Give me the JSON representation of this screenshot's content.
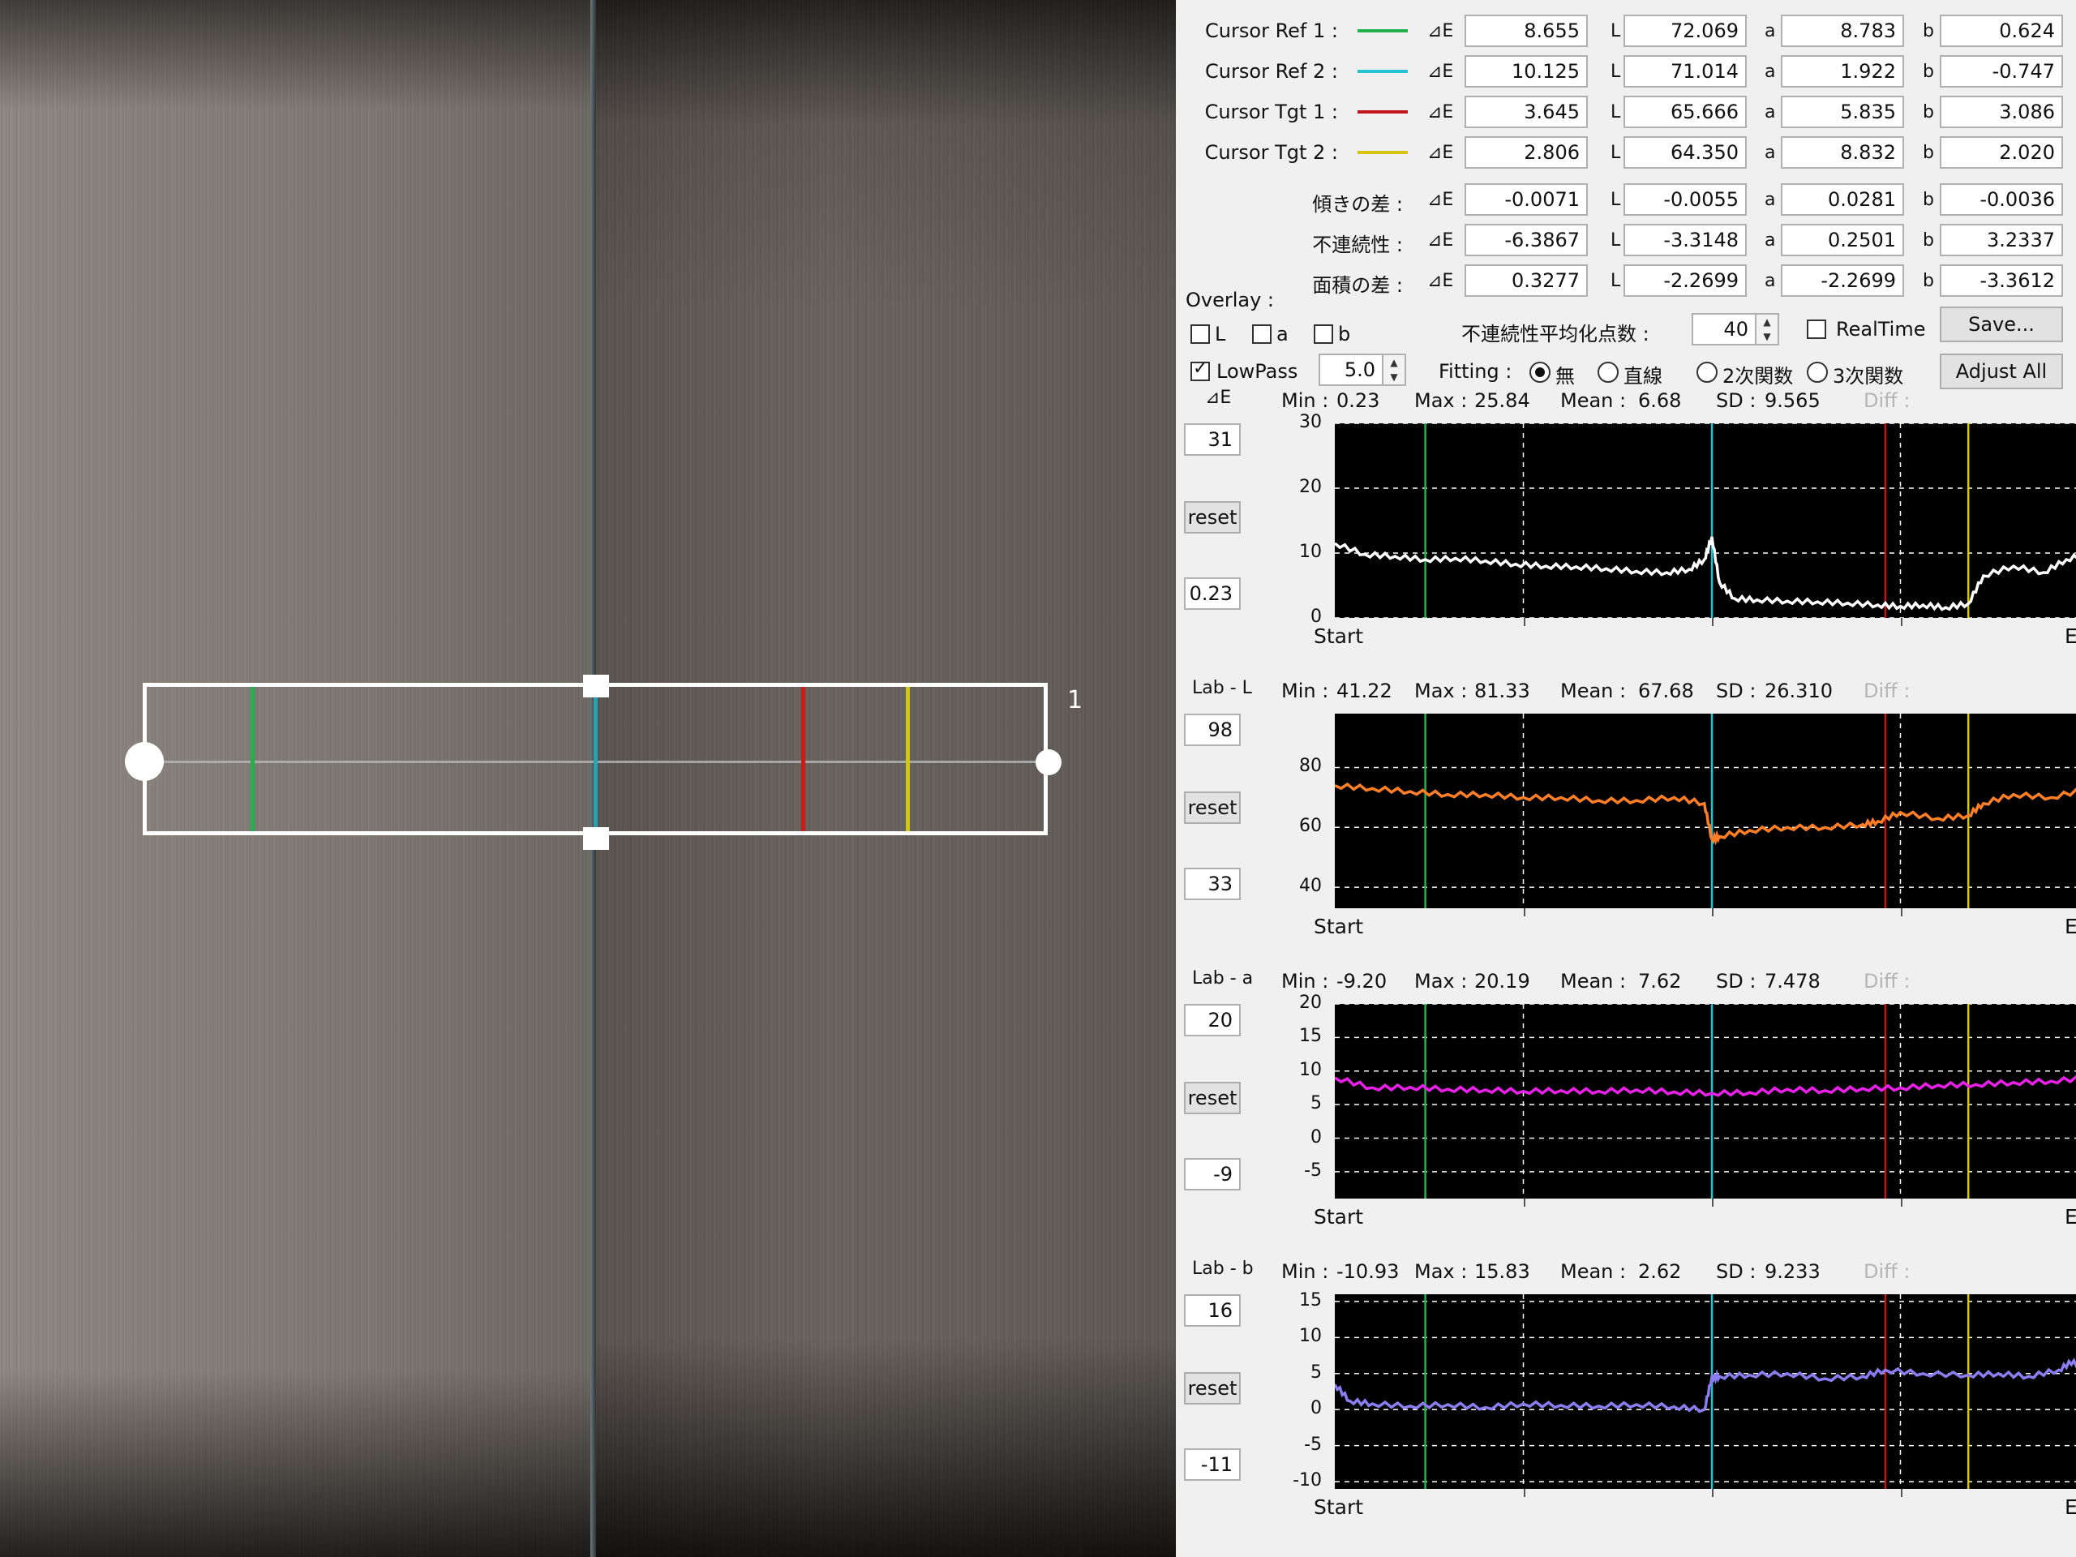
{
  "cursor_rows": [
    {
      "label": "Cursor Ref 1 :",
      "color": "#22b14c",
      "de": "8.655",
      "L": "72.069",
      "a": "8.783",
      "b": "0.624"
    },
    {
      "label": "Cursor Ref 2 :",
      "color": "#27c4cf",
      "de": "10.125",
      "L": "71.014",
      "a": "1.922",
      "b": "-0.747"
    },
    {
      "label": "Cursor Tgt 1 :",
      "color": "#c0151a",
      "de": "3.645",
      "L": "65.666",
      "a": "5.835",
      "b": "3.086"
    },
    {
      "label": "Cursor Tgt 2 :",
      "color": "#d6c413",
      "de": "2.806",
      "L": "64.350",
      "a": "8.832",
      "b": "2.020"
    }
  ],
  "metric_rows": [
    {
      "label": "傾きの差 :",
      "de": "-0.0071",
      "L": "-0.0055",
      "a": "0.0281",
      "b": "-0.0036"
    },
    {
      "label": "不連続性 :",
      "de": "-6.3867",
      "L": "-3.3148",
      "a": "0.2501",
      "b": "3.2337"
    },
    {
      "label": "面積の差 :",
      "de": "0.3277",
      "L": "-2.2699",
      "a": "-2.2699",
      "b": "-3.3612"
    }
  ],
  "col_labels": {
    "de": "⊿E",
    "L": "L",
    "a": "a",
    "b": "b"
  },
  "overlay": {
    "title": "Overlay :",
    "checks": [
      {
        "label": "L",
        "checked": false
      },
      {
        "label": "a",
        "checked": false
      },
      {
        "label": "b",
        "checked": false
      }
    ],
    "smoothing_label": "不連続性平均化点数 :",
    "smoothing_value": "40",
    "realtime_label": "RealTime",
    "realtime_checked": false,
    "save_label": "Save...",
    "lowpass_label": "LowPass",
    "lowpass_checked": true,
    "lowpass_value": "5.0",
    "fitting_label": "Fitting :",
    "fitting_options": [
      {
        "label": "無",
        "selected": true
      },
      {
        "label": "直線",
        "selected": false
      },
      {
        "label": "2次関数",
        "selected": false
      },
      {
        "label": "3次関数",
        "selected": false
      }
    ],
    "adjust_label": "Adjust All"
  },
  "image": {
    "roi_label": "1"
  },
  "stat_labels": {
    "min": "Min :",
    "max": "Max :",
    "mean": "Mean :",
    "sd": "SD :",
    "diff": "Diff :",
    "reset": "reset",
    "start": "Start",
    "end": "End"
  },
  "chart_data": [
    {
      "type": "line",
      "title": "⊿E",
      "color": "#ffffff",
      "min": "0.23",
      "max": "25.84",
      "mean": "6.68",
      "sd": "9.565",
      "range_top": "31",
      "range_bottom": "0.23",
      "ylim": [
        0,
        30
      ],
      "yticks": [
        0,
        10,
        20,
        30
      ],
      "xlabel_start": "Start",
      "xlabel_end": "End",
      "cursors": {
        "ref1": 0.12,
        "ref2": 0.5,
        "tgt1": 0.73,
        "tgt2": 0.84
      },
      "x": [
        0,
        0.04,
        0.08,
        0.12,
        0.16,
        0.2,
        0.24,
        0.28,
        0.32,
        0.36,
        0.4,
        0.44,
        0.47,
        0.49,
        0.5,
        0.51,
        0.53,
        0.56,
        0.6,
        0.64,
        0.68,
        0.72,
        0.75,
        0.78,
        0.81,
        0.84,
        0.86,
        0.9,
        0.94,
        0.97,
        1.0
      ],
      "y": [
        11.5,
        9.8,
        9.5,
        9.0,
        9.2,
        8.8,
        8.3,
        8.0,
        7.9,
        7.6,
        7.2,
        7.0,
        7.5,
        9.0,
        12.5,
        5.5,
        3.0,
        2.8,
        2.6,
        2.5,
        2.3,
        2.0,
        1.8,
        2.0,
        1.6,
        2.2,
        6.5,
        8.0,
        7.0,
        9.0,
        10.0
      ]
    },
    {
      "type": "line",
      "title": "Lab - L",
      "color": "#ff7f27",
      "min": "41.22",
      "max": "81.33",
      "mean": "67.68",
      "sd": "26.310",
      "range_top": "98",
      "range_bottom": "33",
      "ylim": [
        33,
        98
      ],
      "yticks": [
        40,
        60,
        80
      ],
      "xlabel_start": "Start",
      "xlabel_end": "End",
      "cursors": {
        "ref1": 0.12,
        "ref2": 0.5,
        "tgt1": 0.73,
        "tgt2": 0.84
      },
      "x": [
        0,
        0.05,
        0.1,
        0.15,
        0.2,
        0.25,
        0.3,
        0.35,
        0.4,
        0.45,
        0.49,
        0.5,
        0.51,
        0.55,
        0.6,
        0.65,
        0.7,
        0.72,
        0.75,
        0.8,
        0.84,
        0.86,
        0.9,
        0.95,
        1.0
      ],
      "y": [
        74,
        73,
        72,
        71,
        71,
        70,
        70,
        69,
        69,
        70,
        68,
        56,
        57,
        59,
        60,
        60,
        61,
        62,
        65,
        63,
        64,
        68,
        71,
        70,
        73
      ]
    },
    {
      "type": "line",
      "title": "Lab - a",
      "color": "#e820e8",
      "min": "-9.20",
      "max": "20.19",
      "mean": "7.62",
      "sd": "7.478",
      "range_top": "20",
      "range_bottom": "-9",
      "ylim": [
        -9,
        20
      ],
      "yticks": [
        -5,
        0,
        5,
        10,
        15,
        20
      ],
      "xlabel_start": "Start",
      "xlabel_end": "End",
      "cursors": {
        "ref1": 0.12,
        "ref2": 0.5,
        "tgt1": 0.73,
        "tgt2": 0.84
      },
      "x": [
        0,
        0.05,
        0.1,
        0.15,
        0.2,
        0.25,
        0.3,
        0.35,
        0.4,
        0.45,
        0.5,
        0.55,
        0.6,
        0.65,
        0.7,
        0.75,
        0.8,
        0.85,
        0.9,
        0.95,
        1.0
      ],
      "y": [
        9,
        7.5,
        7.6,
        7.3,
        7.2,
        7.0,
        7.1,
        7.0,
        7.2,
        6.9,
        6.7,
        6.8,
        7.3,
        7.1,
        7.4,
        7.5,
        7.9,
        8.0,
        8.3,
        8.5,
        9.0
      ]
    },
    {
      "type": "line",
      "title": "Lab - b",
      "color": "#8b7cf0",
      "min": "-10.93",
      "max": "15.83",
      "mean": "2.62",
      "sd": "9.233",
      "range_top": "16",
      "range_bottom": "-11",
      "ylim": [
        -11,
        16
      ],
      "yticks": [
        -10,
        -5,
        0,
        5,
        10,
        15
      ],
      "xlabel_start": "Start",
      "xlabel_end": "End",
      "cursors": {
        "ref1": 0.12,
        "ref2": 0.5,
        "tgt1": 0.73,
        "tgt2": 0.84
      },
      "x": [
        0,
        0.02,
        0.05,
        0.1,
        0.15,
        0.2,
        0.25,
        0.3,
        0.35,
        0.4,
        0.45,
        0.49,
        0.5,
        0.51,
        0.55,
        0.6,
        0.65,
        0.7,
        0.73,
        0.78,
        0.84,
        0.88,
        0.92,
        0.96,
        0.98,
        1.0
      ],
      "y": [
        3.5,
        1.2,
        0.8,
        0.5,
        0.7,
        0.3,
        0.8,
        0.6,
        0.5,
        0.7,
        0.4,
        0.0,
        4.5,
        4.6,
        4.8,
        5.0,
        4.3,
        4.6,
        5.5,
        5.0,
        4.8,
        5.0,
        4.6,
        5.5,
        6.8,
        4.0
      ]
    }
  ]
}
